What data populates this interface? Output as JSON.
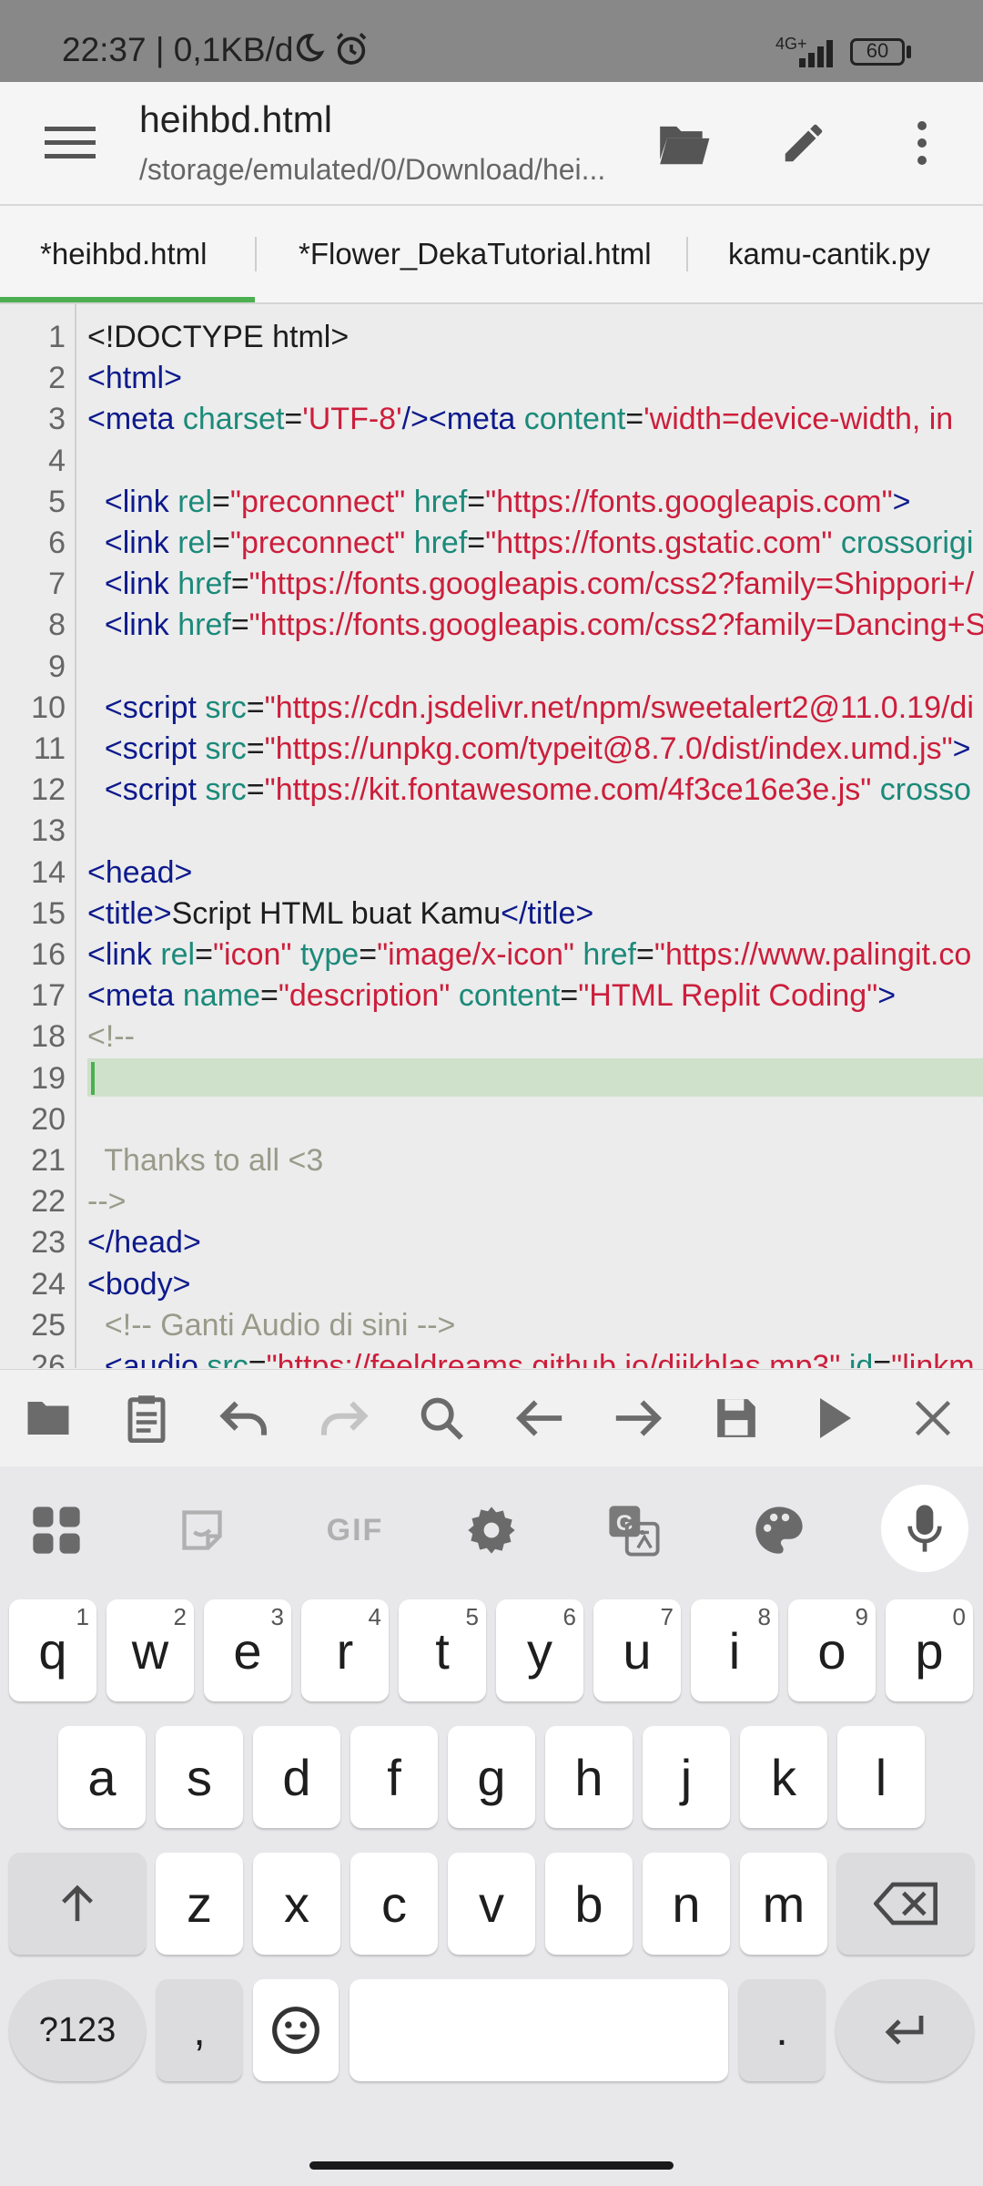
{
  "status_bar": {
    "time_text": "22:37 | 0,1KB/d",
    "network": "4G+",
    "battery": "60",
    "battery_level_percent": 60
  },
  "app_bar": {
    "title": "heihbd.html",
    "path": "/storage/emulated/0/Download/hei..."
  },
  "tabs": [
    {
      "label": "*heihbd.html"
    },
    {
      "label": "*Flower_DekaTutorial.html"
    },
    {
      "label": "kamu-cantik.py"
    }
  ],
  "editor": {
    "lines": [
      {
        "n": "1",
        "tokens": [
          {
            "c": "tx",
            "t": "<!DOCTYPE html>"
          }
        ]
      },
      {
        "n": "2",
        "tokens": [
          {
            "c": "tg",
            "t": "<html>"
          }
        ]
      },
      {
        "n": "3",
        "tokens": [
          {
            "c": "tg",
            "t": "<meta "
          },
          {
            "c": "at",
            "t": "charset"
          },
          {
            "c": "tx",
            "t": "="
          },
          {
            "c": "st",
            "t": "'UTF-8'"
          },
          {
            "c": "tg",
            "t": "/><meta "
          },
          {
            "c": "at",
            "t": "content"
          },
          {
            "c": "tx",
            "t": "="
          },
          {
            "c": "st",
            "t": "'width=device-width, in"
          }
        ]
      },
      {
        "n": "4",
        "tokens": []
      },
      {
        "n": "5",
        "tokens": [
          {
            "c": "tg",
            "t": "  <link "
          },
          {
            "c": "at",
            "t": "rel"
          },
          {
            "c": "tx",
            "t": "="
          },
          {
            "c": "st",
            "t": "\"preconnect\""
          },
          {
            "c": "at",
            "t": " href"
          },
          {
            "c": "tx",
            "t": "="
          },
          {
            "c": "st",
            "t": "\"https://fonts.googleapis.com\""
          },
          {
            "c": "tg",
            "t": ">"
          }
        ]
      },
      {
        "n": "6",
        "tokens": [
          {
            "c": "tg",
            "t": "  <link "
          },
          {
            "c": "at",
            "t": "rel"
          },
          {
            "c": "tx",
            "t": "="
          },
          {
            "c": "st",
            "t": "\"preconnect\""
          },
          {
            "c": "at",
            "t": " href"
          },
          {
            "c": "tx",
            "t": "="
          },
          {
            "c": "st",
            "t": "\"https://fonts.gstatic.com\""
          },
          {
            "c": "at",
            "t": " crossorigi"
          }
        ]
      },
      {
        "n": "7",
        "tokens": [
          {
            "c": "tg",
            "t": "  <link "
          },
          {
            "c": "at",
            "t": "href"
          },
          {
            "c": "tx",
            "t": "="
          },
          {
            "c": "st",
            "t": "\"https://fonts.googleapis.com/css2?family=Shippori+/"
          }
        ]
      },
      {
        "n": "8",
        "tokens": [
          {
            "c": "tg",
            "t": "  <link "
          },
          {
            "c": "at",
            "t": "href"
          },
          {
            "c": "tx",
            "t": "="
          },
          {
            "c": "st",
            "t": "\"https://fonts.googleapis.com/css2?family=Dancing+S"
          }
        ]
      },
      {
        "n": "9",
        "tokens": []
      },
      {
        "n": "10",
        "tokens": [
          {
            "c": "tg",
            "t": "  <script "
          },
          {
            "c": "at",
            "t": "src"
          },
          {
            "c": "tx",
            "t": "="
          },
          {
            "c": "st",
            "t": "\"https://cdn.jsdelivr.net/npm/sweetalert2@11.0.19/di"
          }
        ]
      },
      {
        "n": "11",
        "tokens": [
          {
            "c": "tg",
            "t": "  <script "
          },
          {
            "c": "at",
            "t": "src"
          },
          {
            "c": "tx",
            "t": "="
          },
          {
            "c": "st",
            "t": "\"https://unpkg.com/typeit@8.7.0/dist/index.umd.js\""
          },
          {
            "c": "tg",
            "t": ">"
          }
        ]
      },
      {
        "n": "12",
        "tokens": [
          {
            "c": "tg",
            "t": "  <script "
          },
          {
            "c": "at",
            "t": "src"
          },
          {
            "c": "tx",
            "t": "="
          },
          {
            "c": "st",
            "t": "\"https://kit.fontawesome.com/4f3ce16e3e.js\""
          },
          {
            "c": "at",
            "t": " crosso"
          }
        ]
      },
      {
        "n": "13",
        "tokens": []
      },
      {
        "n": "14",
        "tokens": [
          {
            "c": "tg",
            "t": "<head>"
          }
        ]
      },
      {
        "n": "15",
        "tokens": [
          {
            "c": "tg",
            "t": "<title>"
          },
          {
            "c": "tx",
            "t": "Script HTML buat Kamu"
          },
          {
            "c": "tg",
            "t": "</title>"
          }
        ]
      },
      {
        "n": "16",
        "tokens": [
          {
            "c": "tg",
            "t": "<link "
          },
          {
            "c": "at",
            "t": "rel"
          },
          {
            "c": "tx",
            "t": "="
          },
          {
            "c": "st",
            "t": "\"icon\""
          },
          {
            "c": "at",
            "t": " type"
          },
          {
            "c": "tx",
            "t": "="
          },
          {
            "c": "st",
            "t": "\"image/x-icon\""
          },
          {
            "c": "at",
            "t": " href"
          },
          {
            "c": "tx",
            "t": "="
          },
          {
            "c": "st",
            "t": "\"https://www.palingit.co"
          }
        ]
      },
      {
        "n": "17",
        "tokens": [
          {
            "c": "tg",
            "t": "<meta "
          },
          {
            "c": "at",
            "t": "name"
          },
          {
            "c": "tx",
            "t": "="
          },
          {
            "c": "st",
            "t": "\"description\""
          },
          {
            "c": "at",
            "t": " content"
          },
          {
            "c": "tx",
            "t": "="
          },
          {
            "c": "st",
            "t": "\"HTML Replit Coding\""
          },
          {
            "c": "tg",
            "t": ">"
          }
        ]
      },
      {
        "n": "18",
        "tokens": [
          {
            "c": "cm",
            "t": "<!--"
          }
        ]
      },
      {
        "n": "19",
        "tokens": [],
        "current": true
      },
      {
        "n": "20",
        "tokens": []
      },
      {
        "n": "21",
        "tokens": [
          {
            "c": "cm",
            "t": "  Thanks to all <3"
          }
        ]
      },
      {
        "n": "22",
        "tokens": [
          {
            "c": "cm",
            "t": "-->"
          }
        ]
      },
      {
        "n": "23",
        "tokens": [
          {
            "c": "tg",
            "t": "</head>"
          }
        ]
      },
      {
        "n": "24",
        "tokens": [
          {
            "c": "tg",
            "t": "<body>"
          }
        ]
      },
      {
        "n": "25",
        "tokens": [
          {
            "c": "cm",
            "t": "  <!-- Ganti Audio di sini -->"
          }
        ]
      },
      {
        "n": "26",
        "tokens": [
          {
            "c": "tg",
            "t": "  <audio "
          },
          {
            "c": "at",
            "t": "src"
          },
          {
            "c": "tx",
            "t": "="
          },
          {
            "c": "st",
            "t": "\"https://feeldreams.github.io/dijkhlas.mp3\""
          },
          {
            "c": "at",
            "t": " id"
          },
          {
            "c": "tx",
            "t": "="
          },
          {
            "c": "st",
            "t": "\"linkm"
          }
        ]
      }
    ]
  },
  "toolbar": {
    "icons": [
      "folder-icon",
      "clipboard-icon",
      "undo-icon",
      "redo-icon",
      "search-icon",
      "arrow-left-icon",
      "arrow-right-icon",
      "save-icon",
      "play-icon",
      "close-icon"
    ]
  },
  "keyboard": {
    "top_icons": [
      "apps-grid-icon",
      "sticker-icon",
      "gif-icon",
      "settings-icon",
      "translate-icon",
      "palette-icon",
      "mic-icon"
    ],
    "gif_label": "GIF",
    "row1": [
      {
        "k": "q",
        "h": "1"
      },
      {
        "k": "w",
        "h": "2"
      },
      {
        "k": "e",
        "h": "3"
      },
      {
        "k": "r",
        "h": "4"
      },
      {
        "k": "t",
        "h": "5"
      },
      {
        "k": "y",
        "h": "6"
      },
      {
        "k": "u",
        "h": "7"
      },
      {
        "k": "i",
        "h": "8"
      },
      {
        "k": "o",
        "h": "9"
      },
      {
        "k": "p",
        "h": "0"
      }
    ],
    "row2": [
      "a",
      "s",
      "d",
      "f",
      "g",
      "h",
      "j",
      "k",
      "l"
    ],
    "row3": [
      "z",
      "x",
      "c",
      "v",
      "b",
      "n",
      "m"
    ],
    "symbols_label": "?123",
    "comma_label": ",",
    "period_label": "."
  },
  "colors": {
    "accent": "#4caf50",
    "tag": "#0d1a8c",
    "attribute": "#1b8a7a",
    "string": "#cc1e3b",
    "comment": "#9a9a8a"
  }
}
